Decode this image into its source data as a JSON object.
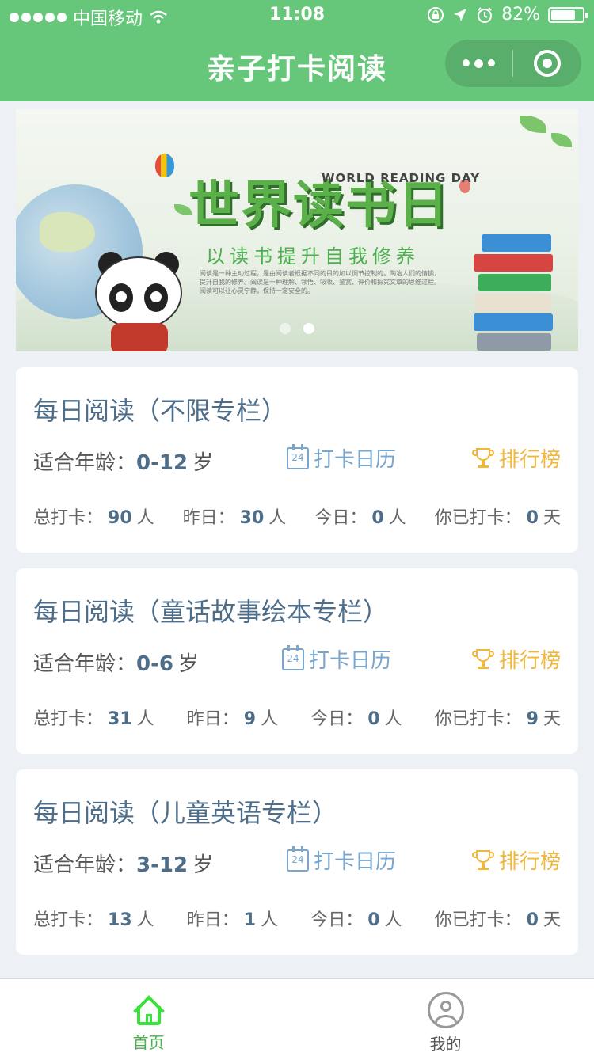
{
  "status_bar": {
    "carrier": "中国移动",
    "time": "11:08",
    "battery": "82%",
    "battery_level": 0.82
  },
  "nav": {
    "title": "亲子打卡阅读"
  },
  "banner": {
    "title": "世界读书日",
    "title_en": "WORLD READING DAY",
    "subtitle": "以读书提升自我修养",
    "body": "阅读是一种主动过程，是由阅读者根据不同的目的加以调节控制的。陶冶人们的情操，提升自我的修养。阅读是一种理解、领悟、吸收、鉴赏、评价和探究文章的思维过程。阅读可以让心灵宁静，保持一定安全的。",
    "slide_count": 2,
    "active_slide": 2
  },
  "cards": [
    {
      "title": "每日阅读（不限专栏）",
      "age_label": "适合年龄：",
      "age_value": "0-12",
      "age_unit": "岁",
      "calendar_label": "打卡日历",
      "calendar_day": "24",
      "rank_label": "排行榜",
      "stats": [
        {
          "label": "总打卡：",
          "value": "90",
          "unit": "人"
        },
        {
          "label": "昨日：",
          "value": "30",
          "unit": "人"
        },
        {
          "label": "今日：",
          "value": "0",
          "unit": "人"
        },
        {
          "label": "你已打卡：",
          "value": "0",
          "unit": "天"
        }
      ]
    },
    {
      "title": "每日阅读（童话故事绘本专栏）",
      "age_label": "适合年龄：",
      "age_value": "0-6",
      "age_unit": "岁",
      "calendar_label": "打卡日历",
      "calendar_day": "24",
      "rank_label": "排行榜",
      "stats": [
        {
          "label": "总打卡：",
          "value": "31",
          "unit": "人"
        },
        {
          "label": "昨日：",
          "value": "9",
          "unit": "人"
        },
        {
          "label": "今日：",
          "value": "0",
          "unit": "人"
        },
        {
          "label": "你已打卡：",
          "value": "9",
          "unit": "天"
        }
      ]
    },
    {
      "title": "每日阅读（儿童英语专栏）",
      "age_label": "适合年龄：",
      "age_value": "3-12",
      "age_unit": "岁",
      "calendar_label": "打卡日历",
      "calendar_day": "24",
      "rank_label": "排行榜",
      "stats": [
        {
          "label": "总打卡：",
          "value": "13",
          "unit": "人"
        },
        {
          "label": "昨日：",
          "value": "1",
          "unit": "人"
        },
        {
          "label": "今日：",
          "value": "0",
          "unit": "人"
        },
        {
          "label": "你已打卡：",
          "value": "0",
          "unit": "天"
        }
      ]
    }
  ],
  "tabbar": {
    "home_label": "首页",
    "me_label": "我的",
    "active_color": "#4cae4c",
    "active": "home"
  },
  "colors": {
    "header": "#66c67a",
    "title_text": "#4d6d89",
    "calendar": "#78a6cf",
    "rank": "#f0b73a",
    "page_bg": "#edf1f5"
  },
  "icons": {
    "status": [
      "signal-dots-icon",
      "wifi-icon",
      "orientation-lock-icon",
      "location-icon",
      "alarm-icon",
      "battery-icon"
    ],
    "capsule": [
      "more-icon",
      "close-circle-icon"
    ],
    "card": [
      "calendar-icon",
      "trophy-icon"
    ],
    "tabbar": [
      "home-icon",
      "profile-icon"
    ]
  }
}
